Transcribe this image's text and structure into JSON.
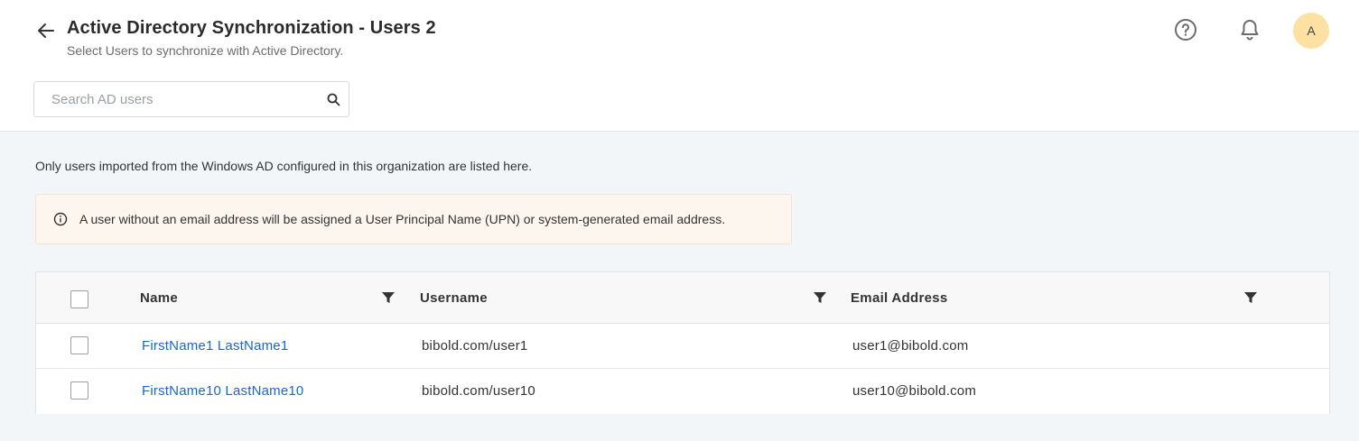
{
  "header": {
    "title": "Active Directory Synchronization - Users 2",
    "subtitle": "Select Users to synchronize with Active Directory.",
    "avatar_initial": "A"
  },
  "search": {
    "placeholder": "Search AD users",
    "value": ""
  },
  "info_text": "Only users imported from the Windows AD configured in this organization are listed here.",
  "notice": {
    "text": "A user without an email address will be assigned a User Principal Name (UPN) or system-generated email address."
  },
  "table": {
    "columns": [
      "Name",
      "Username",
      "Email Address"
    ],
    "rows": [
      {
        "name": "FirstName1 LastName1",
        "username": "bibold.com/user1",
        "email": "user1@bibold.com"
      },
      {
        "name": "FirstName10 LastName10",
        "username": "bibold.com/user10",
        "email": "user10@bibold.com"
      }
    ]
  },
  "icons": [
    "back-arrow-icon",
    "help-icon",
    "bell-icon",
    "search-icon",
    "info-icon",
    "filter-icon"
  ],
  "colors": {
    "link": "#1a66d1",
    "avatar_bg": "#fde1a3",
    "notice_bg": "#fdf6ee",
    "page_bg": "#f3f6f9"
  }
}
